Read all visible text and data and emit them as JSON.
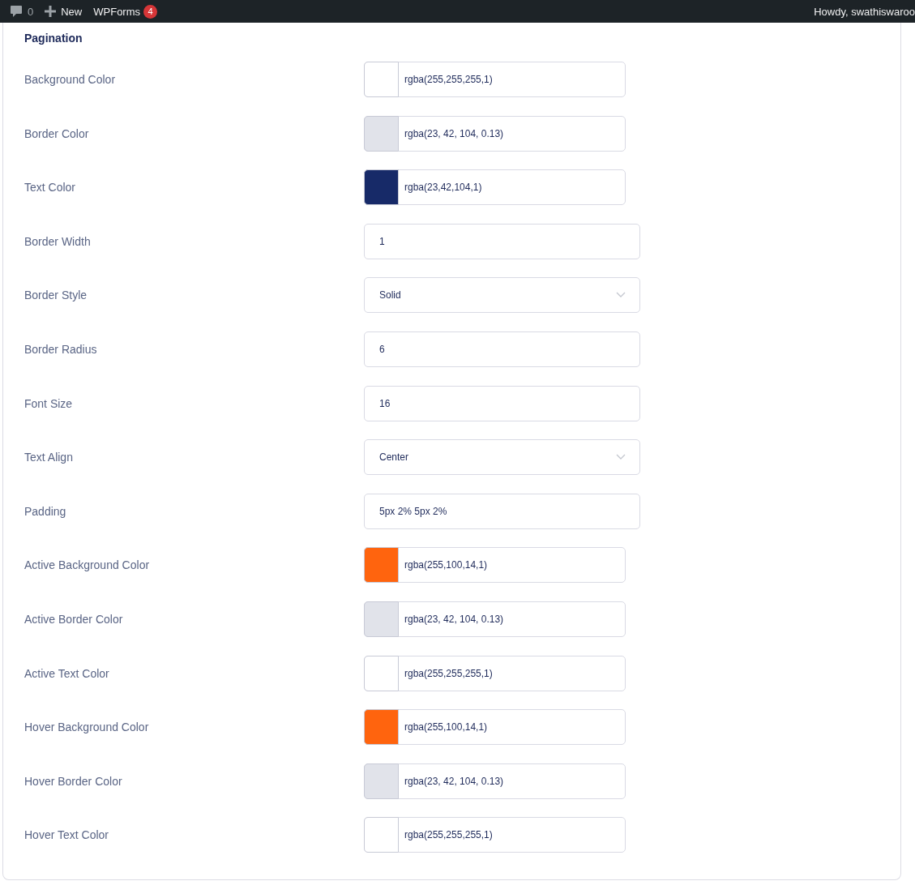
{
  "admin_bar": {
    "comments_count": "0",
    "new_label": "New",
    "plugin_label": "WPForms",
    "plugin_badge": "4",
    "greeting": "Howdy, swathiswaroo"
  },
  "section": {
    "title": "Pagination",
    "fields": [
      {
        "label": "Background Color",
        "kind": "color",
        "color": "#ffffff",
        "value": "rgba(255,255,255,1)"
      },
      {
        "label": "Border Color",
        "kind": "color",
        "color": "#e1e3ea",
        "value": "rgba(23, 42, 104, 0.13)"
      },
      {
        "label": "Text Color",
        "kind": "color",
        "color": "#172a68",
        "value": "rgba(23,42,104,1)"
      },
      {
        "label": "Border Width",
        "kind": "text",
        "value": "1"
      },
      {
        "label": "Border Style",
        "kind": "select",
        "value": "Solid"
      },
      {
        "label": "Border Radius",
        "kind": "text",
        "value": "6"
      },
      {
        "label": "Font Size",
        "kind": "text",
        "value": "16"
      },
      {
        "label": "Text Align",
        "kind": "select",
        "value": "Center"
      },
      {
        "label": "Padding",
        "kind": "text",
        "value": "5px 2% 5px 2%"
      },
      {
        "label": "Active Background Color",
        "kind": "color",
        "color": "#ff640e",
        "value": "rgba(255,100,14,1)"
      },
      {
        "label": "Active Border Color",
        "kind": "color",
        "color": "#e1e3ea",
        "value": "rgba(23, 42, 104, 0.13)"
      },
      {
        "label": "Active Text Color",
        "kind": "color",
        "color": "#ffffff",
        "value": "rgba(255,255,255,1)"
      },
      {
        "label": "Hover Background Color",
        "kind": "color",
        "color": "#ff640e",
        "value": "rgba(255,100,14,1)"
      },
      {
        "label": "Hover Border Color",
        "kind": "color",
        "color": "#e1e3ea",
        "value": "rgba(23, 42, 104, 0.13)"
      },
      {
        "label": "Hover Text Color",
        "kind": "color",
        "color": "#ffffff",
        "value": "rgba(255,255,255,1)"
      }
    ]
  }
}
